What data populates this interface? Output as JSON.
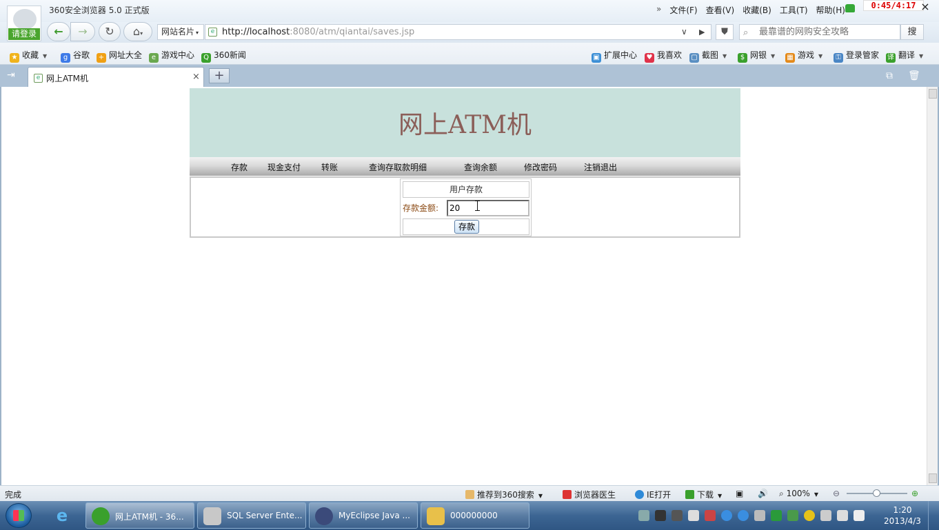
{
  "browser": {
    "app_title": "360安全浏览器 5.0 正式版",
    "login_label": "请登录",
    "menu": [
      "文件(F)",
      "查看(V)",
      "收藏(B)",
      "工具(T)",
      "帮助(H)"
    ],
    "menu_chevron": "»",
    "timer": "0:45/4:17",
    "close_glyph": "×"
  },
  "navbar": {
    "site_card_label": "网站名片",
    "url_host": "http://localhost",
    "url_rest": ":8080/atm/qiantai/saves.jsp",
    "search_placeholder": "最靠谱的网购安全攻略",
    "search_button": "搜"
  },
  "bookmarks": {
    "left": [
      {
        "label": "收藏",
        "icon": "star-icon",
        "color": "#f0b31c"
      },
      {
        "label": "谷歌",
        "icon": "google-icon",
        "color": "#3d7ae8"
      },
      {
        "label": "网址大全",
        "icon": "plus-globe-icon",
        "color": "#f0a014"
      },
      {
        "label": "游戏中心",
        "icon": "page-icon",
        "color": "#6aa84f"
      },
      {
        "label": "360新闻",
        "icon": "search-news-icon",
        "color": "#3aa02c"
      }
    ],
    "right": [
      {
        "label": "扩展中心",
        "icon": "cube-icon",
        "color": "#3c8fd6"
      },
      {
        "label": "我喜欢",
        "icon": "heart-icon",
        "color": "#e0324a"
      },
      {
        "label": "截图",
        "icon": "screenshot-icon",
        "color": "#5a8fc2"
      },
      {
        "label": "网银",
        "icon": "bank-icon",
        "color": "#3aa02c"
      },
      {
        "label": "游戏",
        "icon": "gamepad-icon",
        "color": "#e48a1a"
      },
      {
        "label": "登录管家",
        "icon": "key-icon",
        "color": "#4a86c5"
      },
      {
        "label": "翻译",
        "icon": "translate-icon",
        "color": "#3aa02c"
      }
    ]
  },
  "tabs": {
    "active_title": "网上ATM机",
    "close_glyph": "×",
    "new_tab_glyph": "+"
  },
  "page": {
    "title": "网上ATM机",
    "nav": [
      "存款",
      "现金支付",
      "转账",
      "查询存取款明细",
      "查询余额",
      "修改密码",
      "注销退出"
    ],
    "form_title": "用户存款",
    "amount_label": "存款金额:",
    "amount_value": "20",
    "submit_label": "存款"
  },
  "statusbar": {
    "status": "完成",
    "recommend": "推荐到360搜索",
    "doctor": "浏览器医生",
    "ie_open": "IE打开",
    "download": "下载",
    "zoom": "100%"
  },
  "taskbar": {
    "tasks": [
      {
        "label": "网上ATM机 - 36...",
        "icon": "360-browser-icon",
        "color": "#3aa02c"
      },
      {
        "label": "SQL Server Ente...",
        "icon": "sql-server-icon",
        "color": "#c8c8c8"
      },
      {
        "label": "MyEclipse Java ...",
        "icon": "myeclipse-icon",
        "color": "#3b4a7a"
      },
      {
        "label": "000000000",
        "icon": "folder-icon",
        "color": "#e8c04a"
      }
    ],
    "clock_time": "1:20",
    "clock_date": "2013/4/3"
  }
}
